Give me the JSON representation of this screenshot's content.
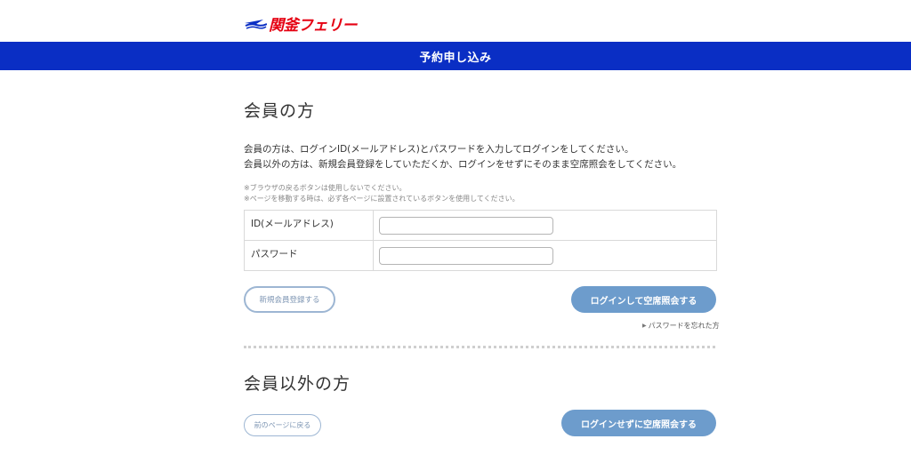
{
  "header": {
    "logo_text": "関釜フェリー",
    "banner_title": "予約申し込み"
  },
  "members": {
    "title": "会員の方",
    "intro_line1": "会員の方は、ログインID(メールアドレス)とパスワードを入力してログインをしてください。",
    "intro_line2": "会員以外の方は、新規会員登録をしていただくか、ログインをせずにそのまま空席照会をしてください。",
    "note_line1": "※ブラウザの戻るボタンは使用しないでください。",
    "note_line2": "※ページを移動する時は、必ず各ページに設置されているボタンを使用してください。",
    "id_label": "ID(メールアドレス)",
    "id_value": "",
    "password_label": "パスワード",
    "password_value": "",
    "register_button": "新規会員登録する",
    "login_button": "ログインして空席照会する",
    "forgot_link": "パスワードを忘れた方"
  },
  "guests": {
    "title": "会員以外の方",
    "back_button": "前のページに戻る",
    "guest_button": "ログインせずに空席照会する"
  },
  "colors": {
    "banner": "#0a2ec4",
    "logo": "#e50012",
    "primary_button": "#6d9ccc",
    "outline_button": "#9db6d3"
  }
}
